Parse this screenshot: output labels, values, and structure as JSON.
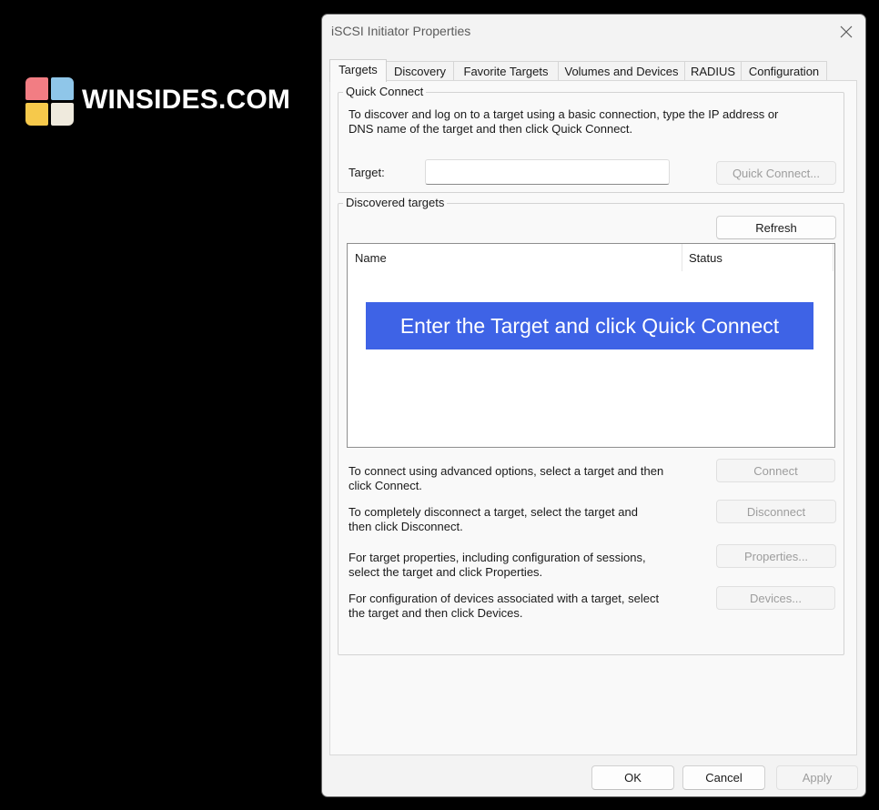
{
  "watermark": {
    "text": "WINSIDES.COM",
    "colors": [
      "#f27d83",
      "#8fc6e9",
      "#f6c94b",
      "#efeadd"
    ]
  },
  "window": {
    "title": "iSCSI Initiator Properties",
    "close_icon": "close-icon"
  },
  "tabs": [
    {
      "label": "Targets",
      "active": true
    },
    {
      "label": "Discovery"
    },
    {
      "label": "Favorite Targets"
    },
    {
      "label": "Volumes and Devices"
    },
    {
      "label": "RADIUS"
    },
    {
      "label": "Configuration"
    }
  ],
  "quick_connect": {
    "group_label": "Quick Connect",
    "description_line1": "To discover and log on to a target using a basic connection, type the IP address or",
    "description_line2": "DNS name of the target and then click Quick Connect.",
    "target_label": "Target:",
    "target_value": "",
    "button_label": "Quick Connect..."
  },
  "discovered_targets": {
    "group_label": "Discovered targets",
    "refresh_label": "Refresh",
    "columns": [
      "Name",
      "Status"
    ],
    "rows": []
  },
  "actions": [
    {
      "line1": "To connect using advanced options, select a target and then",
      "line2": "click Connect.",
      "button": "Connect"
    },
    {
      "line1": "To completely disconnect a target, select the target and",
      "line2": "then click Disconnect.",
      "button": "Disconnect"
    },
    {
      "line1": "For target properties, including configuration of sessions,",
      "line2": "select the target and click Properties.",
      "button": "Properties..."
    },
    {
      "line1": "For configuration of devices associated with a target, select",
      "line2": "the target and then click Devices.",
      "button": "Devices..."
    }
  ],
  "footer": {
    "ok_label": "OK",
    "cancel_label": "Cancel",
    "apply_label": "Apply"
  },
  "overlay": {
    "text": "Enter the Target and click Quick Connect",
    "color": "#3e63e6"
  }
}
